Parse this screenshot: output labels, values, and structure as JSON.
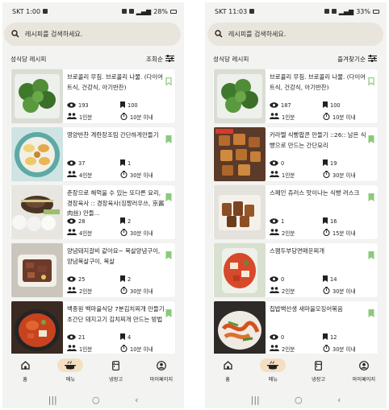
{
  "left": {
    "status": {
      "time": "SKT 1:00",
      "battery": "28%"
    },
    "search_placeholder": "레시피를 검색하세요.",
    "section_title": "성식당 레시피",
    "sort_label": "조회순",
    "recipes": [
      {
        "title": "브로콜리 무침. 브로콜리 나물. (다이어트식, 건강식, 아기반찬)",
        "views": "193",
        "bookmarks": "100",
        "servings": "1인분",
        "time": "10분 이내",
        "bookmark_state": "outline"
      },
      {
        "title": "영양반찬 계란장조림 간단하게만들기",
        "views": "37",
        "bookmarks": "1",
        "servings": "4인분",
        "time": "30분 이내",
        "bookmark_state": "filled"
      },
      {
        "title": "춘장으로 해먹을 수 있는 또다른 요리, 경장육사 :: 경장육사(징짱러우쓰, 京酱肉丝) 만들...",
        "views": "28",
        "bookmarks": "2",
        "servings": "4인분",
        "time": "30분 이내",
        "bookmark_state": "filled"
      },
      {
        "title": "양념돼지갈비 같아요~ 목살양념구이, 양념목살구이, 목살",
        "views": "25",
        "bookmarks": "2",
        "servings": "2인분",
        "time": "30분 이내",
        "bookmark_state": "filled"
      },
      {
        "title": "백종원 백마을식당 7분김치찌개 만들기 초간단 돼지고기 김치찌개 만드는 방법",
        "views": "21",
        "bookmarks": "4",
        "servings": "1인분",
        "time": "10분 이내",
        "bookmark_state": "filled"
      }
    ]
  },
  "right": {
    "status": {
      "time": "SKT 11:03",
      "battery": "33%"
    },
    "search_placeholder": "레시피를 검색하세요.",
    "section_title": "성식당 레시피",
    "sort_label": "즐겨찾기순",
    "recipes": [
      {
        "title": "브로콜리 무침. 브로콜리 나물. (다이어트식, 건강식, 아기반찬)",
        "views": "187",
        "bookmarks": "100",
        "servings": "1인분",
        "time": "10분 이내",
        "bookmark_state": "outline"
      },
      {
        "title": "카라멜 식빵팝콘 만들기 ::26:: 남은 식빵으로 만드는 간단요리",
        "views": "0",
        "bookmarks": "19",
        "servings": "1인분",
        "time": "30분 이내",
        "bookmark_state": "filled"
      },
      {
        "title": "스페인 츄러스 맛이나는 식빵 러스크",
        "views": "1",
        "bookmarks": "16",
        "servings": "2인분",
        "time": "15분 이내",
        "bookmark_state": "filled"
      },
      {
        "title": "스팸두부당면매운찌개",
        "views": "0",
        "bookmarks": "14",
        "servings": "2인분",
        "time": "30분 이내",
        "bookmark_state": "filled"
      },
      {
        "title": "집밥백선생 새마을오징어볶음",
        "views": "0",
        "bookmarks": "12",
        "servings": "2인분",
        "time": "30분 이내",
        "bookmark_state": "filled"
      }
    ]
  },
  "nav": [
    {
      "label": "홈",
      "icon": "home-icon"
    },
    {
      "label": "메뉴",
      "icon": "cooking-pot-icon"
    },
    {
      "label": "냉장고",
      "icon": "fridge-icon"
    },
    {
      "label": "마이페이지",
      "icon": "account-icon"
    }
  ],
  "nav_active_index": 1,
  "system_nav": {
    "recents": "|||",
    "home": "○",
    "back": "‹"
  },
  "colors": {
    "accent_green": "#8bc97b",
    "nav_active_bg": "#f4dfc2",
    "search_bg": "#eae5dc",
    "screen_bg": "#f3f3f1"
  }
}
